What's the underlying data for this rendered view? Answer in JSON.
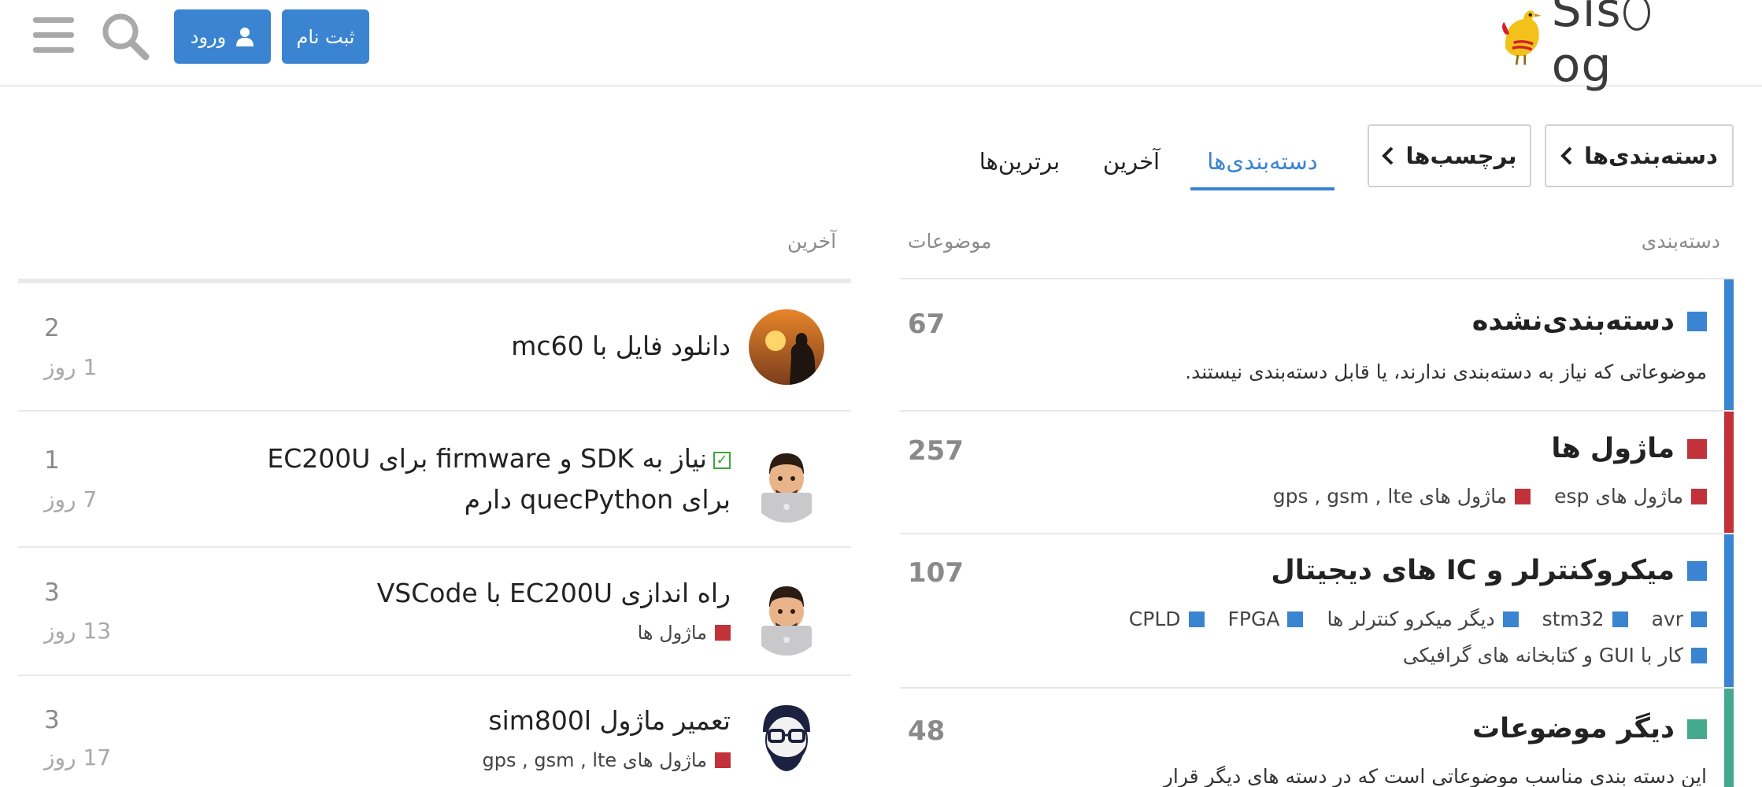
{
  "header": {
    "logo_text_a": "Sis",
    "logo_text_b": "og",
    "signup_label": "ثبت نام",
    "login_label": "ورود"
  },
  "nav": {
    "categories_pill": "دسته‌بندی‌ها",
    "tags_pill": "برچسب‌ها",
    "tab_categories": "دسته‌بندی‌ها",
    "tab_latest": "آخرین",
    "tab_top": "برترین‌ها"
  },
  "columns": {
    "category": "دسته‌بندی",
    "topics": "موضوعات",
    "latest": "آخرین"
  },
  "categories": [
    {
      "name": "دسته‌بندی‌نشده",
      "color": "#3a84d1",
      "count": "67",
      "description": "موضوعاتی که نیاز به دسته‌بندی ندارند، یا قابل دسته‌بندی نیستند."
    },
    {
      "name": "ماژول ها",
      "color": "#c2323a",
      "count": "257",
      "subcategories": [
        "ماژول های esp",
        "ماژول های gps , gsm , lte"
      ]
    },
    {
      "name": "میکروکنترلر و IC های دیجیتال",
      "color": "#3a84d1",
      "count": "107",
      "subcategories": [
        "avr",
        "stm32",
        "دیگر میکرو کنترلر ها",
        "FPGA",
        "CPLD",
        "کار با GUI و کتابخانه های گرافیکی"
      ]
    },
    {
      "name": "دیگر موضوعات",
      "color": "#45a98e",
      "count": "48",
      "description": "این دسته بندی مناسب موضوعاتی است که در دسته های دیگر قرار"
    }
  ],
  "latest": [
    {
      "title": "دانلود فایل با mc60",
      "count": "2",
      "age": "1 روز"
    },
    {
      "title_line1": "نیاز به SDK و firmware برای EC200U",
      "title_line2": "برای quecPython دارم",
      "count": "1",
      "age": "7 روز"
    },
    {
      "title": "راه اندازی EC200U با VSCode",
      "category": "ماژول ها",
      "count": "3",
      "age": "13 روز"
    },
    {
      "title": "تعمیر ماژول sim800l",
      "category": "ماژول های gps , gsm , lte",
      "count": "3",
      "age": "17 روز"
    }
  ],
  "colors": {
    "accent": "#3a84d1",
    "red": "#c2323a",
    "green": "#45a98e",
    "muted": "#8a8a8a"
  }
}
